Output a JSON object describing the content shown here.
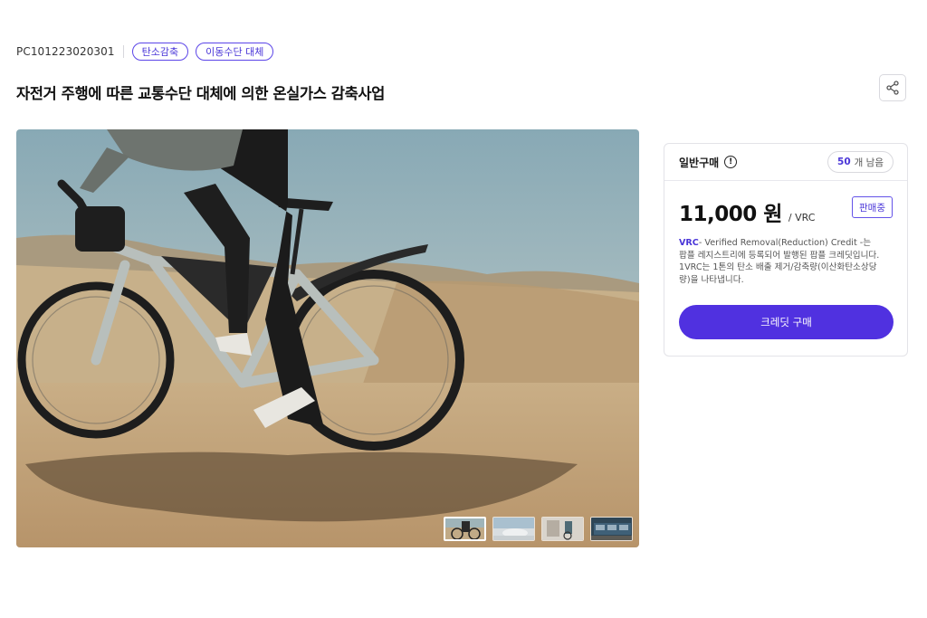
{
  "header": {
    "project_code": "PC101223020301",
    "tags": [
      "탄소감축",
      "이동수단 대체"
    ],
    "title": "자전거 주행에 따른 교통수단 대체에 의한 온실가스 감축사업"
  },
  "gallery": {
    "main_image": "cyclist-riding-gravel-bike-on-dirt-road",
    "thumbnails": [
      "cyclist-bike",
      "snowy-dome-landscape",
      "cyclist-with-wall",
      "people-walking-blue-bus"
    ],
    "active_thumbnail": 0
  },
  "purchase": {
    "type_label": "일반구매",
    "info_icon_glyph": "!",
    "remaining_count": "50",
    "remaining_suffix": "개 남음",
    "price": "11,000 원",
    "unit": "/ VRC",
    "status": "판매중",
    "desc_highlight": "VRC",
    "desc_rest_line1": "- Verified Removal(Reduction) Credit -는",
    "desc_rest_line2": "팝플 레지스트리에 등록되어 발행된 팝플 크레딧입니다.",
    "desc_rest_line3": "1VRC는 1톤의 탄소 배출 제거/감축량(이산화탄소상당",
    "desc_rest_line4": "량)을 나타냅니다.",
    "cta_label": "크레딧 구매"
  },
  "colors": {
    "accent": "#5031e0",
    "tag_border": "#5b45e8"
  }
}
